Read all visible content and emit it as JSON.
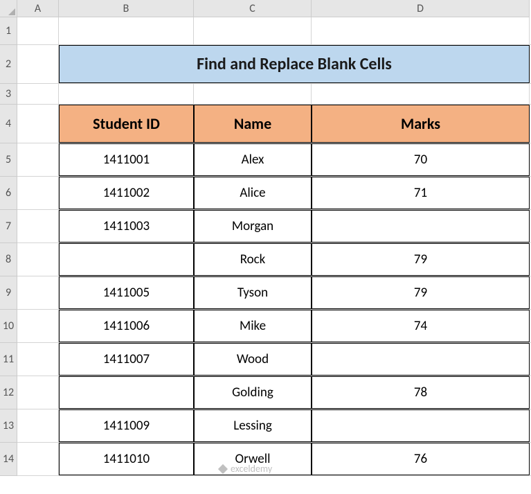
{
  "columns": {
    "A": "A",
    "B": "B",
    "C": "C",
    "D": "D"
  },
  "rowNumbers": [
    "1",
    "2",
    "3",
    "4",
    "5",
    "6",
    "7",
    "8",
    "9",
    "10",
    "11",
    "12",
    "13",
    "14"
  ],
  "title": "Find and Replace Blank Cells",
  "headers": {
    "studentId": "Student ID",
    "name": "Name",
    "marks": "Marks"
  },
  "rows": [
    {
      "id": "1411001",
      "name": "Alex",
      "marks": "70"
    },
    {
      "id": "1411002",
      "name": "Alice",
      "marks": "71"
    },
    {
      "id": "1411003",
      "name": "Morgan",
      "marks": ""
    },
    {
      "id": "",
      "name": "Rock",
      "marks": "79"
    },
    {
      "id": "1411005",
      "name": "Tyson",
      "marks": "79"
    },
    {
      "id": "1411006",
      "name": "Mike",
      "marks": "74"
    },
    {
      "id": "1411007",
      "name": "Wood",
      "marks": ""
    },
    {
      "id": "",
      "name": "Golding",
      "marks": "78"
    },
    {
      "id": "1411009",
      "name": "Lessing",
      "marks": ""
    },
    {
      "id": "1411010",
      "name": "Orwell",
      "marks": "76"
    }
  ],
  "watermark": "exceldemy"
}
